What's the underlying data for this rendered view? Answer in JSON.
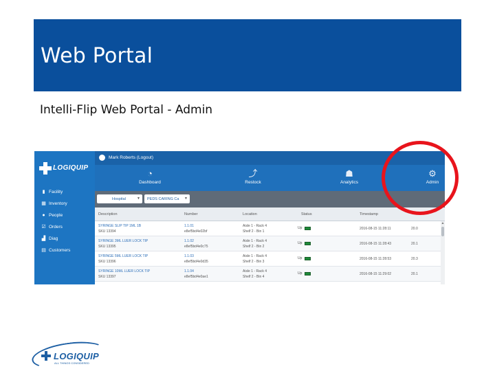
{
  "slide": {
    "title": "Web Portal",
    "subtitle": "Intelli-Flip Web Portal - Admin"
  },
  "app": {
    "logo_text": "LOGIQUIP",
    "user_label": "Mark Roberts (Logout)",
    "sidebar": {
      "items": [
        {
          "label": "Facility",
          "icon": "building-icon"
        },
        {
          "label": "Inventory",
          "icon": "grid-icon"
        },
        {
          "label": "People",
          "icon": "person-icon"
        },
        {
          "label": "Orders",
          "icon": "checkbox-icon"
        },
        {
          "label": "Diag",
          "icon": "chart-icon"
        },
        {
          "label": "Customers",
          "icon": "store-icon"
        }
      ]
    },
    "nav": {
      "dashboard": "Dashboard",
      "restock": "Restock",
      "analytics": "Analytics",
      "admin": "Admin"
    },
    "filters": {
      "first": "Hospital",
      "second": "PEDS CARING Ca"
    },
    "table": {
      "columns": [
        "Description",
        "Number",
        "Location",
        "Status",
        "Timestamp",
        ""
      ],
      "rows": [
        {
          "desc": "SYRINGE SLIP TIP 1ML 1B",
          "sku": "SKU 13394",
          "num": "1.1.01",
          "code": "e8ef5bd4e02bf",
          "loc": "Aisle 1 - Rack 4",
          "loc2": "Shelf 2 - Bin 1",
          "status": "Up",
          "ts": "2016-08-15 11:28:11",
          "val": "20.0"
        },
        {
          "desc": "SYRINGE 3ML LUER LOCK TIP",
          "sku": "SKU 13395",
          "num": "1.1.02",
          "code": "e8ef5bd4e0c75",
          "loc": "Aisle 1 - Rack 4",
          "loc2": "Shelf 2 - Bin 2",
          "status": "Up",
          "ts": "2016-08-15 11:28:43",
          "val": "20.1"
        },
        {
          "desc": "SYRINGE 5ML LUER LOCK TIP",
          "sku": "SKU 13396",
          "num": "1.1.03",
          "code": "e8ef5bd4e0d35",
          "loc": "Aisle 1 - Rack 4",
          "loc2": "Shelf 2 - Bin 3",
          "status": "Up",
          "ts": "2016-08-15 11:28:53",
          "val": "20.3"
        },
        {
          "desc": "SYRINGE 10ML LUER LOCK TIP",
          "sku": "SKU 13397",
          "num": "1.1.04",
          "code": "e8ef5bd4e0ae1",
          "loc": "Aisle 1 - Rack 4",
          "loc2": "Shelf 2 - Bin 4",
          "status": "Up",
          "ts": "2016-08-15 11:29:02",
          "val": "20.1"
        }
      ]
    }
  },
  "footer": {
    "logo_text": "LOGIQUIP",
    "tagline": "ALL THINGS CONSIDERED"
  },
  "colors": {
    "header_blue": "#0a4f9c",
    "highlight_red": "#e8141c",
    "sidebar_blue": "#1d75c2"
  }
}
